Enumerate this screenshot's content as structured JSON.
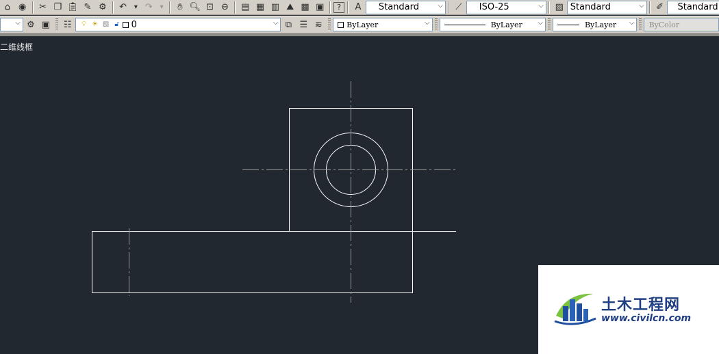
{
  "toolbar_top": {
    "text_style": "Standard",
    "dim_style": "ISO-25",
    "table_style": "Standard",
    "mleader_style": "Standard"
  },
  "toolbar_layers": {
    "layer_name": "0",
    "color": "ByLayer",
    "linetype": "ByLayer",
    "lineweight": "ByLayer",
    "plotstyle": "ByColor"
  },
  "viewport": {
    "label": "二维线框",
    "background": "#212830",
    "line_color": "#ffffff",
    "centerline_color": "#9a9a9a"
  },
  "watermark": {
    "brand": "土木工程网",
    "url": "www.civilcn.com"
  }
}
